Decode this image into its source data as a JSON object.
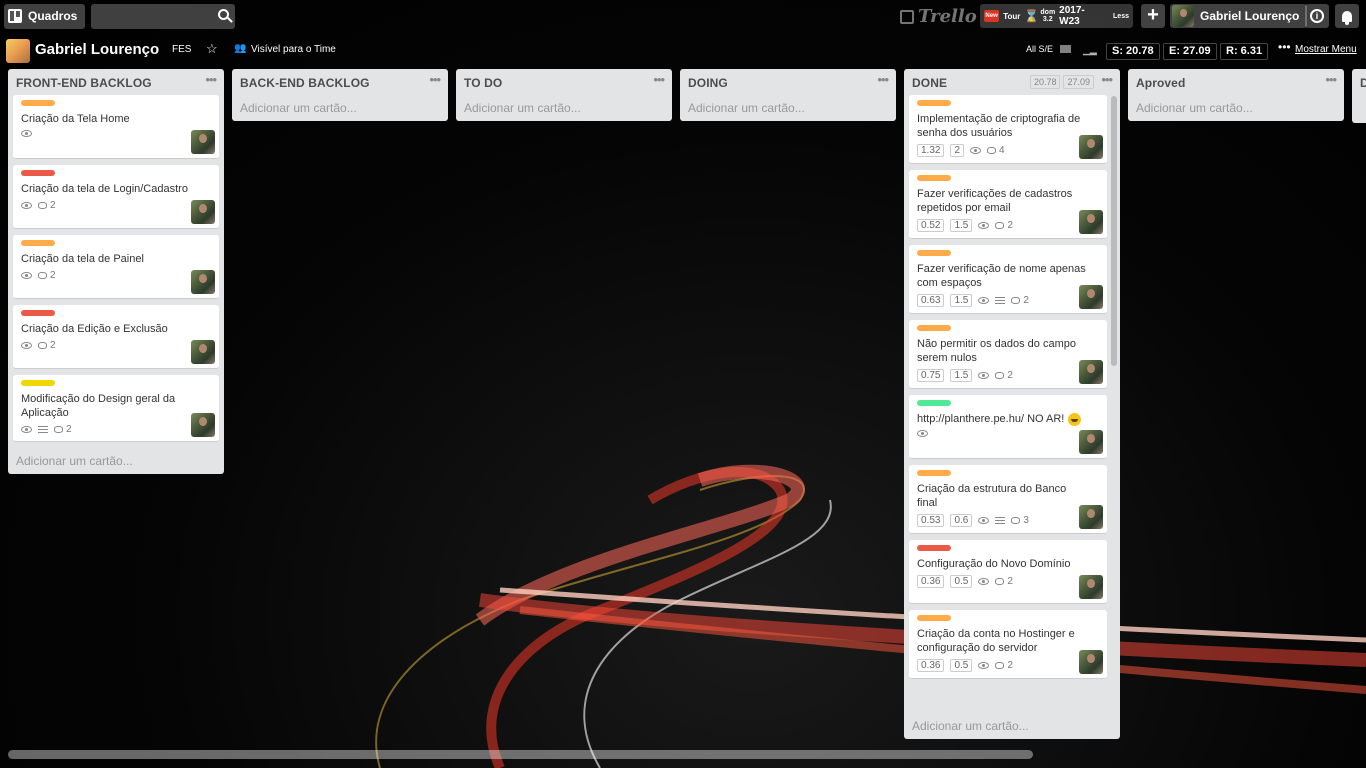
{
  "header": {
    "boards_label": "Quadros",
    "logo_text": "Trello",
    "plugin": {
      "new_badge": "New",
      "tour": "Tour",
      "day": "dom",
      "day_num": "3.2",
      "week": "2017-W23",
      "less": "Less"
    },
    "user_name": "Gabriel Lourenço"
  },
  "board": {
    "title": "Gabriel Lourenço",
    "team": "FES",
    "visibility": "Visível para o Time",
    "all_se": "All S/E",
    "metrics": {
      "s": "S: 20.78",
      "e": "E: 27.09",
      "r": "R: 6.31"
    },
    "menu": "Mostrar Menu"
  },
  "lists": [
    {
      "title": "FRONT-END BACKLOG",
      "add": "Adicionar um cartão...",
      "cards": [
        {
          "label_color": "#ffab4a",
          "title": "Criação da Tela Home",
          "comments": null
        },
        {
          "label_color": "#eb5a46",
          "title": "Criação da tela de Login/Cadastro",
          "comments": "2"
        },
        {
          "label_color": "#ffab4a",
          "title": "Criação da tela de Painel",
          "comments": "2"
        },
        {
          "label_color": "#eb5a46",
          "title": "Criação da Edição e Exclusão",
          "comments": "2"
        },
        {
          "label_color": "#f2d600",
          "title": "Modificação do Design geral da Aplicação",
          "comments": "2",
          "desc": true
        }
      ]
    },
    {
      "title": "BACK-END BACKLOG",
      "add": "Adicionar um cartão..."
    },
    {
      "title": "TO DO",
      "add": "Adicionar um cartão..."
    },
    {
      "title": "DOING",
      "add": "Adicionar um cartão..."
    },
    {
      "title": "DONE",
      "add": "Adicionar um cartão...",
      "badges": [
        "20.78",
        "27.09"
      ],
      "cards": [
        {
          "label_color": "#ffab4a",
          "title": "Implementação de criptografia de senha dos usuários",
          "n1": "1.32",
          "n2": "2",
          "comments": "4"
        },
        {
          "label_color": "#ffab4a",
          "title": "Fazer verificações de cadastros repetidos por email",
          "n1": "0.52",
          "n2": "1.5",
          "comments": "2"
        },
        {
          "label_color": "#ffab4a",
          "title": "Fazer verificação de nome apenas com espaços",
          "n1": "0.63",
          "n2": "1.5",
          "comments": "2",
          "desc": true
        },
        {
          "label_color": "#ffab4a",
          "title": "Não permitir os dados do campo serem nulos",
          "n1": "0.75",
          "n2": "1.5",
          "comments": "2"
        },
        {
          "label_color": "#51e898",
          "title": "http://planthere.pe.hu/ NO AR!",
          "emoji": true
        },
        {
          "label_color": "#ffab4a",
          "title": "Criação da estrutura do Banco final",
          "n1": "0.53",
          "n2": "0.6",
          "comments": "3",
          "desc": true
        },
        {
          "label_color": "#eb5a46",
          "title": "Configuração do Novo Domínio",
          "n1": "0.36",
          "n2": "0.5",
          "comments": "2"
        },
        {
          "label_color": "#ffab4a",
          "title": "Criação da conta no Hostinger e configuração do servidor",
          "n1": "0.36",
          "n2": "0.5",
          "comments": "2"
        }
      ]
    },
    {
      "title": "Aproved",
      "add": "Adicionar um cartão..."
    },
    {
      "title": "D"
    }
  ]
}
